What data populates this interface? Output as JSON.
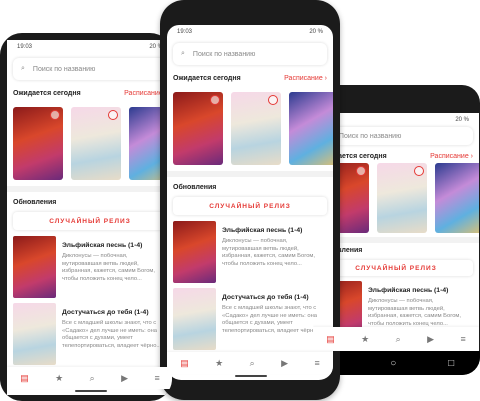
{
  "status": {
    "time": "19:03",
    "battery": "20 %"
  },
  "search": {
    "placeholder": "Поиск по названию"
  },
  "today": {
    "title": "Ожидается сегодня",
    "schedule_link": "Расписание ›"
  },
  "updates": {
    "title": "Обновления",
    "random_button": "СЛУЧАЙНЫЙ РЕЛИЗ"
  },
  "releases": [
    {
      "title": "Эльфийская песнь (1-4)",
      "desc": "Диклонусы — побочная, мутировавшая ветвь людей, избранная, кажется, самим Богом, чтобы положить конец чело..."
    },
    {
      "title": "Достучаться до тебя (1-4)",
      "desc": "Все с младшей школы знают, что с «Садако» дел лучше не иметь: она общается с духами, умеет телепортироваться, владеет чёрно..."
    }
  ],
  "bottom_nav": [
    {
      "icon": "feed-icon",
      "glyph": "▤"
    },
    {
      "icon": "star-icon",
      "glyph": "★"
    },
    {
      "icon": "search-icon",
      "glyph": "⌕"
    },
    {
      "icon": "video-icon",
      "glyph": "▶"
    },
    {
      "icon": "menu-icon",
      "glyph": "≡"
    }
  ],
  "android_nav": [
    "◁",
    "○",
    "□"
  ],
  "accent": "#e53935"
}
